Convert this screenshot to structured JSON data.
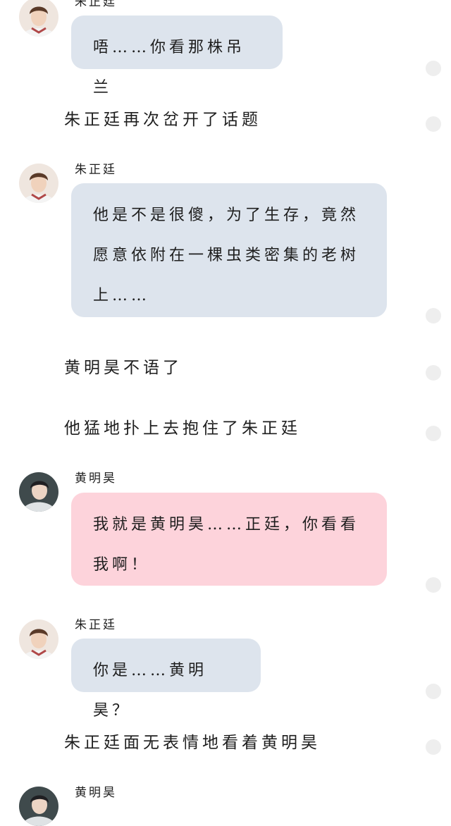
{
  "messages": [
    {
      "sender": "朱正廷",
      "text": "唔……你看那株吊兰"
    },
    {
      "narration": "朱正廷再次岔开了话题"
    },
    {
      "sender": "朱正廷",
      "text": "他是不是很傻，为了生存，竟然愿意依附在一棵虫类密集的老树上……"
    },
    {
      "narration": "黄明昊不语了"
    },
    {
      "narration": "他猛地扑上去抱住了朱正廷"
    },
    {
      "sender": "黄明昊",
      "text": "我就是黄明昊……正廷，你看看我啊！"
    },
    {
      "sender": "朱正廷",
      "text": "你是……黄明昊？"
    },
    {
      "narration": "朱正廷面无表情地看着黄明昊"
    },
    {
      "sender": "黄明昊",
      "text": ""
    }
  ],
  "colors": {
    "bubble_zhu": "#dde4ed",
    "bubble_huang": "#fdd3db",
    "text": "#1e1e1e",
    "background": "#ffffff",
    "side_dot": "#eeeeee"
  }
}
